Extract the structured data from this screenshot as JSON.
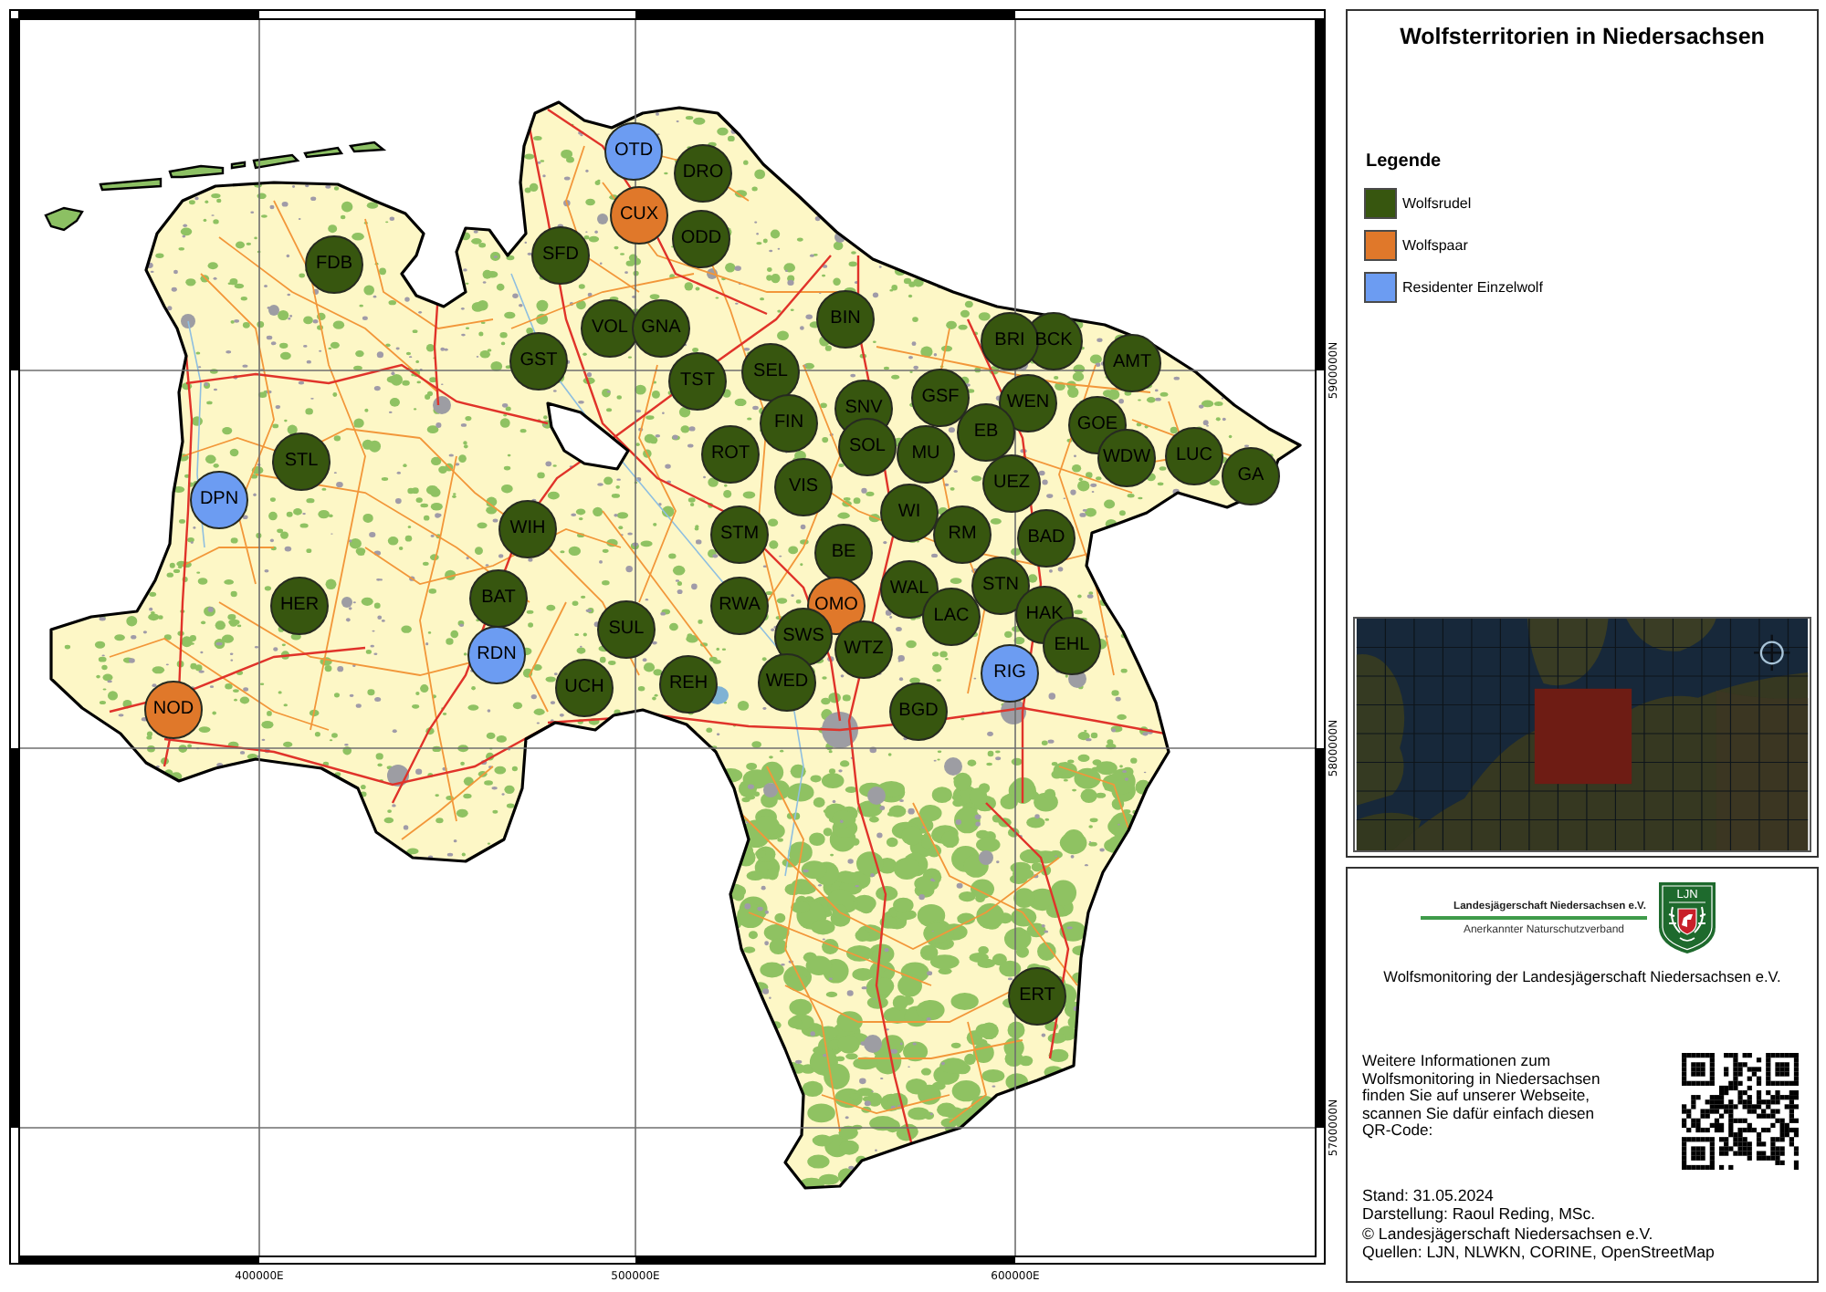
{
  "map": {
    "territories": [
      {
        "code": "OTD",
        "kind": "einzelwolf"
      },
      {
        "code": "DRO",
        "kind": "rudel"
      },
      {
        "code": "CUX",
        "kind": "paar"
      },
      {
        "code": "ODD",
        "kind": "rudel"
      },
      {
        "code": "SFD",
        "kind": "rudel"
      },
      {
        "code": "FDB",
        "kind": "rudel"
      },
      {
        "code": "BIN",
        "kind": "rudel"
      },
      {
        "code": "VOL",
        "kind": "rudel"
      },
      {
        "code": "GNA",
        "kind": "rudel"
      },
      {
        "code": "BCK",
        "kind": "rudel"
      },
      {
        "code": "BRI",
        "kind": "rudel"
      },
      {
        "code": "GST",
        "kind": "rudel"
      },
      {
        "code": "AMT",
        "kind": "rudel"
      },
      {
        "code": "SEL",
        "kind": "rudel"
      },
      {
        "code": "TST",
        "kind": "rudel"
      },
      {
        "code": "GSF",
        "kind": "rudel"
      },
      {
        "code": "WEN",
        "kind": "rudel"
      },
      {
        "code": "SNV",
        "kind": "rudel"
      },
      {
        "code": "FIN",
        "kind": "rudel"
      },
      {
        "code": "GOE",
        "kind": "rudel"
      },
      {
        "code": "EB",
        "kind": "rudel"
      },
      {
        "code": "SOL",
        "kind": "rudel"
      },
      {
        "code": "STL",
        "kind": "rudel"
      },
      {
        "code": "ROT",
        "kind": "rudel"
      },
      {
        "code": "MU",
        "kind": "rudel"
      },
      {
        "code": "WDW",
        "kind": "rudel"
      },
      {
        "code": "LUC",
        "kind": "rudel"
      },
      {
        "code": "GA",
        "kind": "rudel"
      },
      {
        "code": "VIS",
        "kind": "rudel"
      },
      {
        "code": "UEZ",
        "kind": "rudel"
      },
      {
        "code": "DPN",
        "kind": "einzelwolf"
      },
      {
        "code": "WI",
        "kind": "rudel"
      },
      {
        "code": "WIH",
        "kind": "rudel"
      },
      {
        "code": "STM",
        "kind": "rudel"
      },
      {
        "code": "RM",
        "kind": "rudel"
      },
      {
        "code": "BAD",
        "kind": "rudel"
      },
      {
        "code": "BE",
        "kind": "rudel"
      },
      {
        "code": "WAL",
        "kind": "rudel"
      },
      {
        "code": "STN",
        "kind": "rudel"
      },
      {
        "code": "HER",
        "kind": "rudel"
      },
      {
        "code": "BAT",
        "kind": "rudel"
      },
      {
        "code": "RWA",
        "kind": "rudel"
      },
      {
        "code": "OMO",
        "kind": "paar"
      },
      {
        "code": "LAC",
        "kind": "rudel"
      },
      {
        "code": "HAK",
        "kind": "rudel"
      },
      {
        "code": "SUL",
        "kind": "rudel"
      },
      {
        "code": "SWS",
        "kind": "rudel"
      },
      {
        "code": "RDN",
        "kind": "einzelwolf"
      },
      {
        "code": "WTZ",
        "kind": "rudel"
      },
      {
        "code": "EHL",
        "kind": "rudel"
      },
      {
        "code": "RIG",
        "kind": "einzelwolf"
      },
      {
        "code": "UCH",
        "kind": "rudel"
      },
      {
        "code": "REH",
        "kind": "rudel"
      },
      {
        "code": "WED",
        "kind": "rudel"
      },
      {
        "code": "NOD",
        "kind": "paar"
      },
      {
        "code": "BGD",
        "kind": "rudel"
      },
      {
        "code": "ERT",
        "kind": "rudel"
      }
    ],
    "x_axis_labels": [
      "400000E",
      "500000E",
      "600000E"
    ],
    "y_axis_labels": [
      "5900000N",
      "5800000N",
      "5700000N"
    ]
  },
  "legend_panel": {
    "title": "Wolfsterritorien in Niedersachsen",
    "legend": {
      "heading": "Legende",
      "items": [
        {
          "kind": "rudel",
          "label": "Wolfsrudel",
          "color": "#37560f"
        },
        {
          "kind": "paar",
          "label": "Wolfspaar",
          "color": "#e0782a"
        },
        {
          "kind": "einzelwolf",
          "label": "Residenter Einzelwolf",
          "color": "#6c9cf2"
        }
      ]
    }
  },
  "info_panel": {
    "organization": {
      "name": "Landesjägerschaft Niedersachsen e.V.",
      "tagline": "Anerkannter Naturschutzverband",
      "shield_text": "LJN"
    },
    "caption": "Wolfsmonitoring der Landesjägerschaft Niedersachsen e.V.",
    "info_lines": [
      "Weitere Informationen zum",
      "Wolfsmonitoring in Niedersachsen",
      "finden Sie auf unserer Webseite,",
      "scannen Sie dafür einfach diesen",
      "QR-Code:"
    ],
    "credits": [
      "Stand: 31.05.2024",
      "Darstellung: Raoul Reding, MSc.",
      "© Landesjägerschaft Niedersachsen e.V.",
      "Quellen: LJN, NLWKN, CORINE, OpenStreetMap"
    ]
  }
}
